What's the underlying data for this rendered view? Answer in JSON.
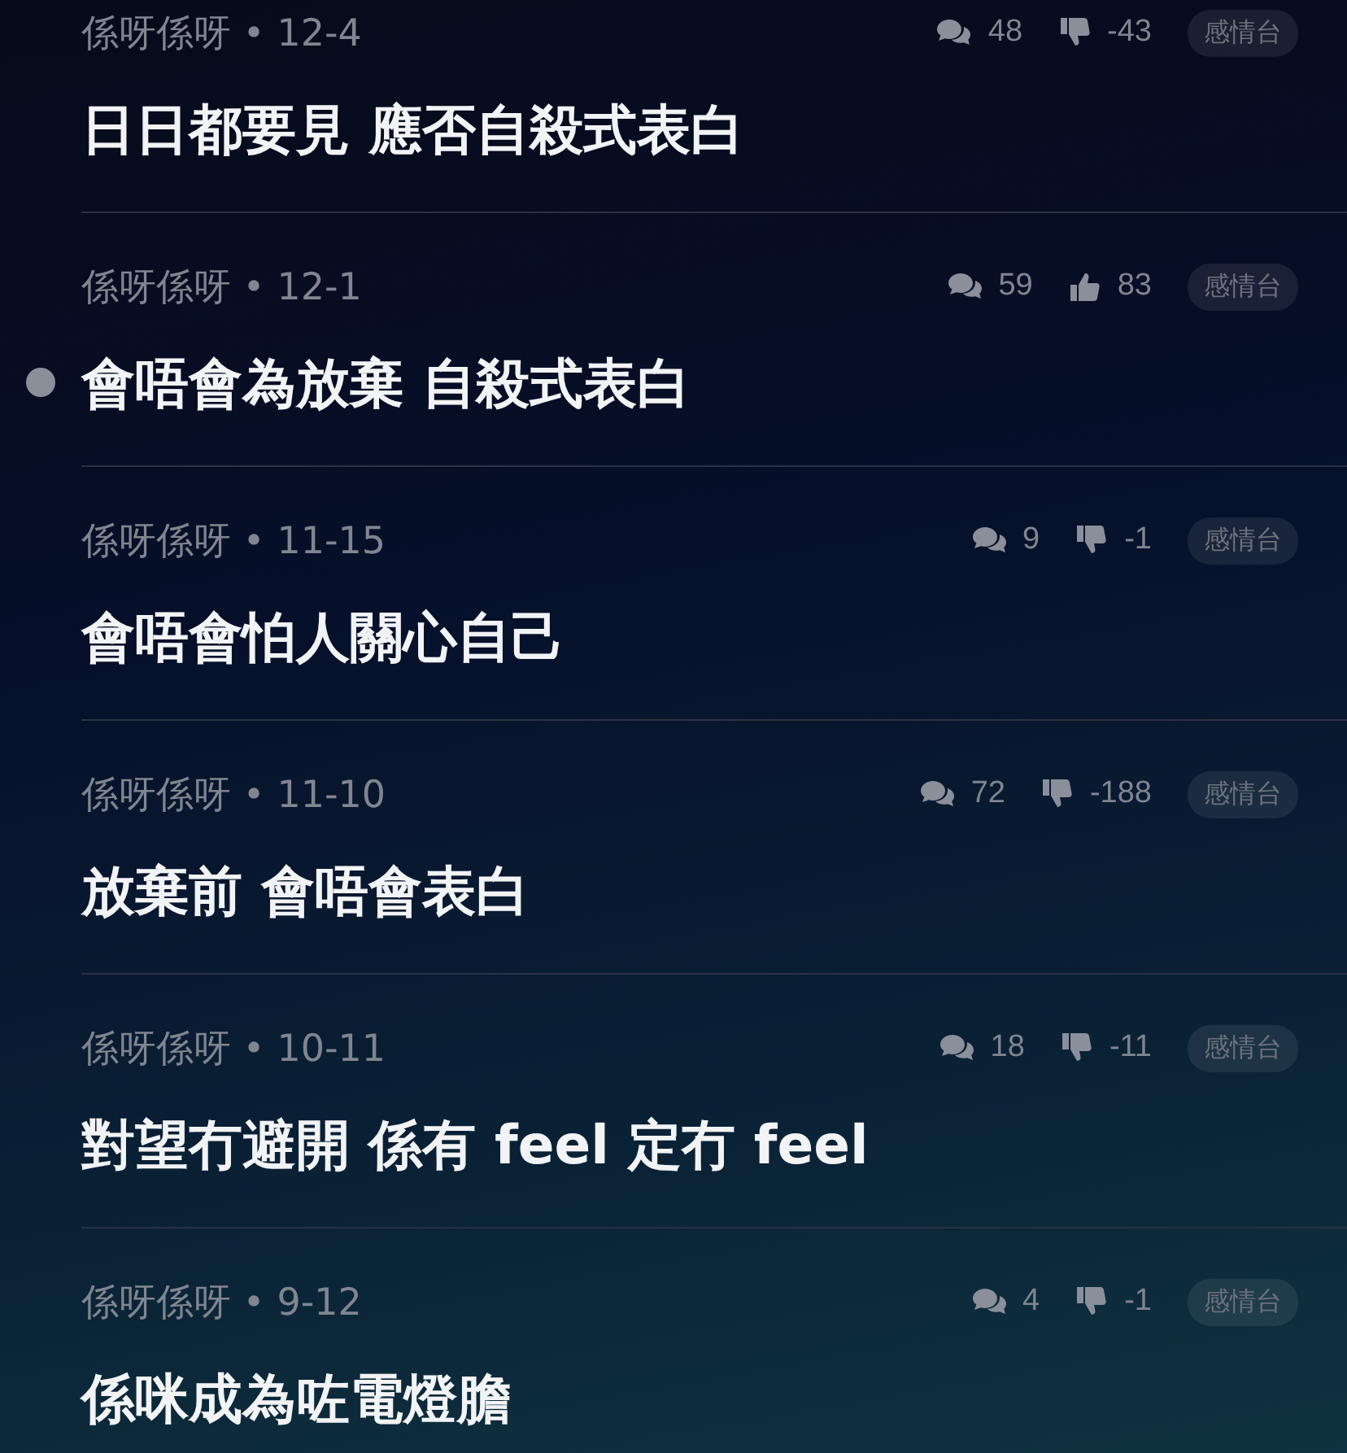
{
  "posts": [
    {
      "meta": "係呀係呀 • 12-4",
      "comments": "48",
      "thumbs_up": false,
      "votes": "-43",
      "tag": "感情台",
      "title": "日日都要見 應否自殺式表白",
      "unread": false
    },
    {
      "meta": "係呀係呀 • 12-1",
      "comments": "59",
      "thumbs_up": true,
      "votes": "83",
      "tag": "感情台",
      "title": "會唔會為放棄 自殺式表白",
      "unread": true
    },
    {
      "meta": "係呀係呀 • 11-15",
      "comments": "9",
      "thumbs_up": false,
      "votes": "-1",
      "tag": "感情台",
      "title": "會唔會怕人關心自己",
      "unread": false
    },
    {
      "meta": "係呀係呀 • 11-10",
      "comments": "72",
      "thumbs_up": false,
      "votes": "-188",
      "tag": "感情台",
      "title": "放棄前 會唔會表白",
      "unread": false
    },
    {
      "meta": "係呀係呀 • 10-11",
      "comments": "18",
      "thumbs_up": false,
      "votes": "-11",
      "tag": "感情台",
      "title": "對望冇避開 係有 feel 定冇 feel",
      "unread": false
    },
    {
      "meta": "係呀係呀 • 9-12",
      "comments": "4",
      "thumbs_up": false,
      "votes": "-1",
      "tag": "感情台",
      "title": "係咪成為咗電燈膽",
      "unread": false
    }
  ]
}
